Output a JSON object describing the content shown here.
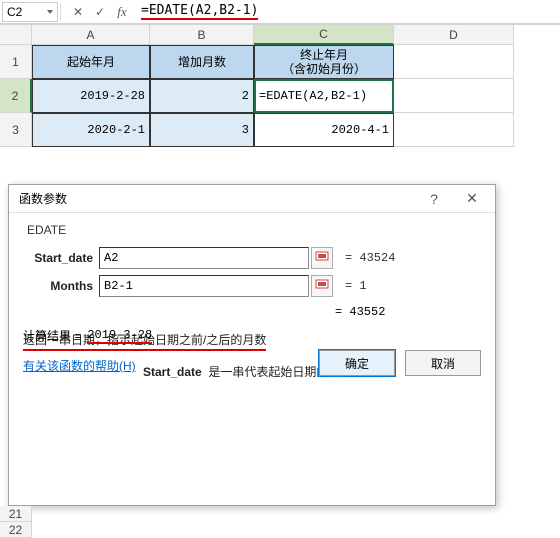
{
  "formula_bar": {
    "name_box": "C2",
    "formula": "=EDATE(A2,B2-1)"
  },
  "columns": [
    "A",
    "B",
    "C",
    "D"
  ],
  "headers": {
    "A": "起始年月",
    "B": "增加月数",
    "C": "终止年月\n（含初始月份）"
  },
  "rows": [
    {
      "n": "1"
    },
    {
      "n": "2",
      "A": "2019-2-28",
      "B": "2",
      "C": "=EDATE(A2,B2-1)"
    },
    {
      "n": "3",
      "A": "2020-2-1",
      "B": "3",
      "C": "2020-4-1"
    }
  ],
  "extra_rows": [
    "21",
    "22"
  ],
  "dialog": {
    "title": "函数参数",
    "func": "EDATE",
    "args": [
      {
        "label": "Start_date",
        "value": "A2",
        "result": "= 43524"
      },
      {
        "label": "Months",
        "value": "B2-1",
        "result": "= 1"
      }
    ],
    "return_label": "= 43552",
    "description": "返回一串日期，指示起始日期之前/之后的月数",
    "sub_desc_label": "Start_date",
    "sub_desc_text": "是一串代表起始日期的日期",
    "calc_label": "计算结果 =",
    "calc_value": "2019-3-28",
    "help_link": "有关该函数的帮助(H)",
    "ok": "确定",
    "cancel": "取消"
  }
}
